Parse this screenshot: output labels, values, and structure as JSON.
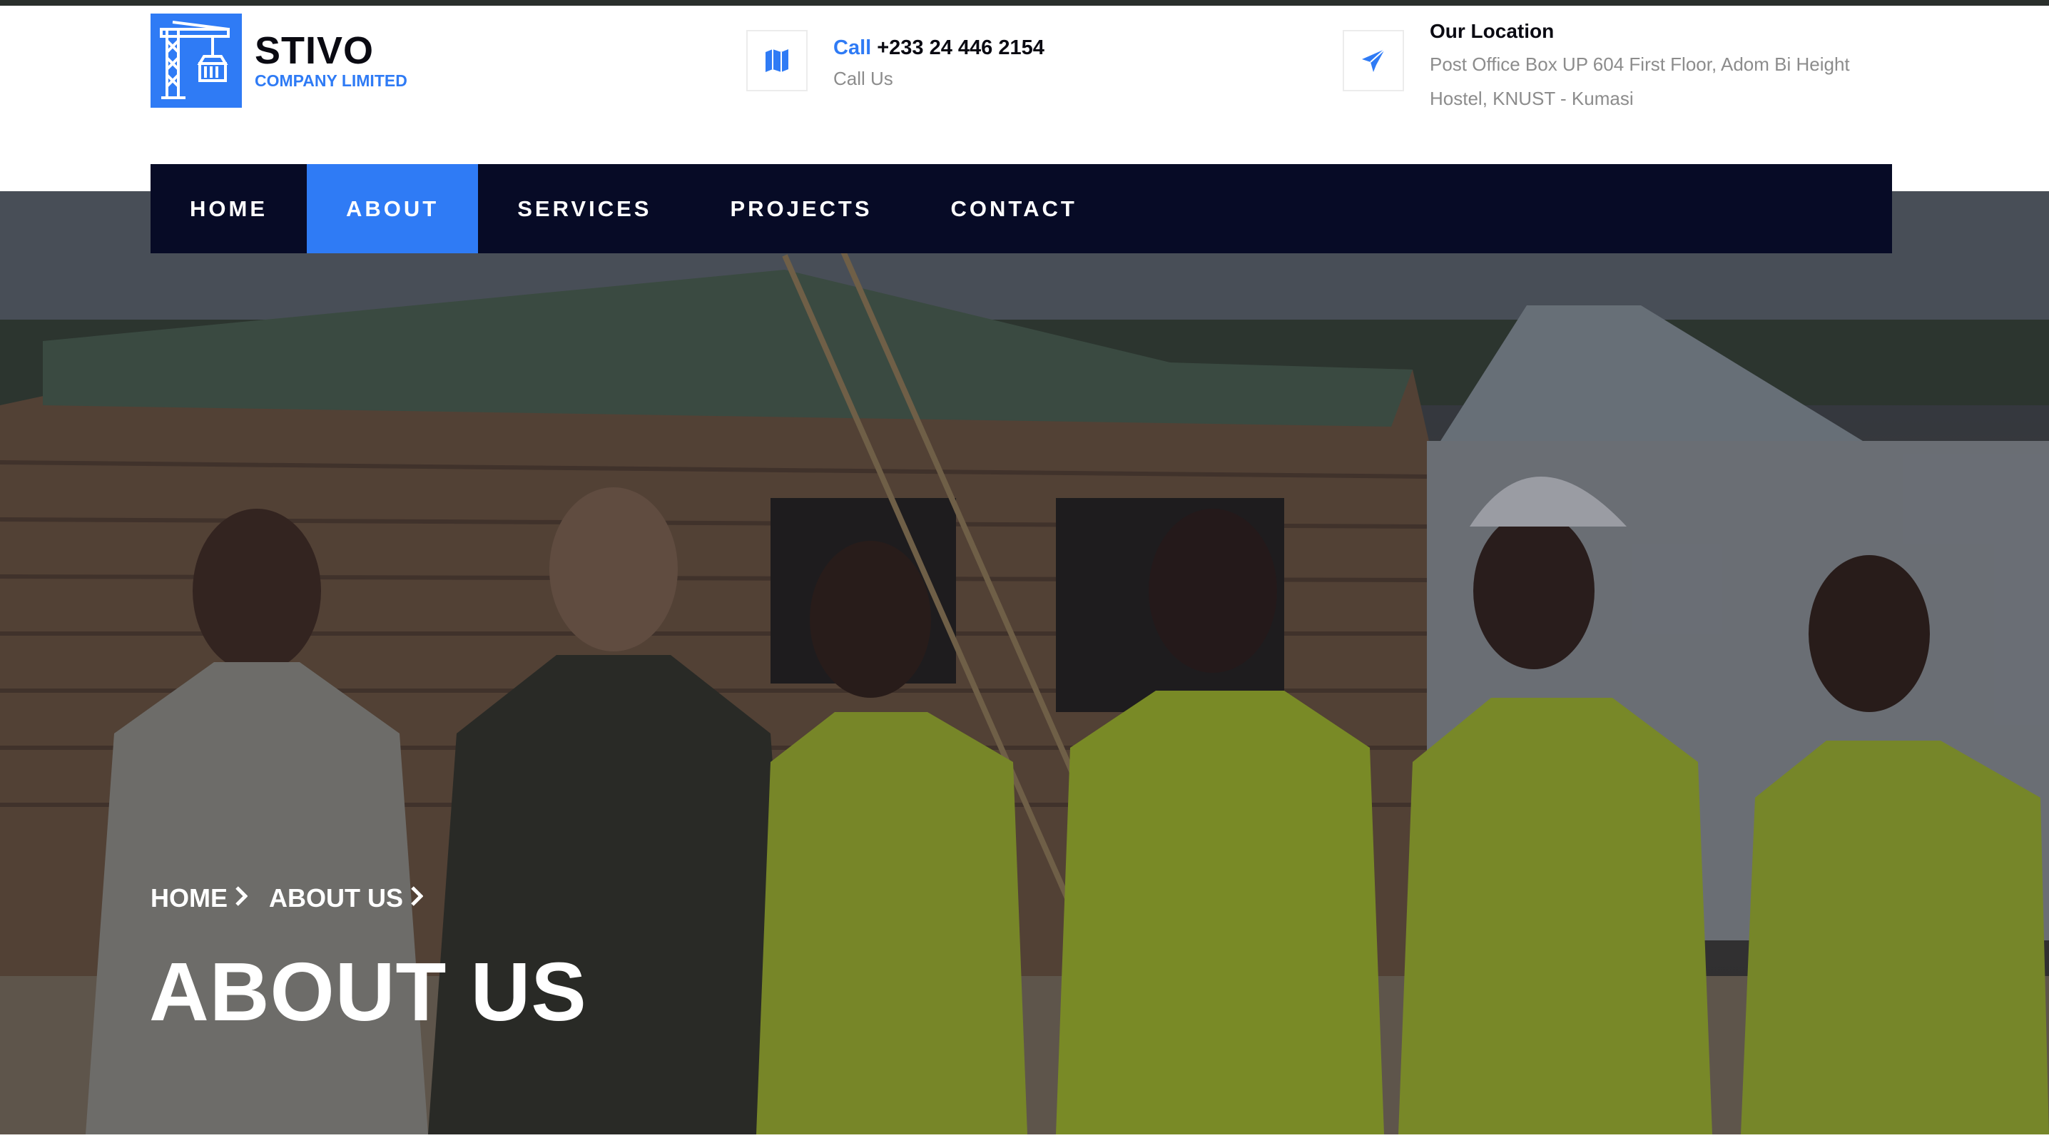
{
  "brand": {
    "name": "STIVO",
    "subtitle": "COMPANY LIMITED",
    "accent_color": "#2f7bf5",
    "logo_icon": "tower-crane-icon"
  },
  "contact": {
    "call_label": "Call",
    "phone": "+233 24 446 2154",
    "call_caption": "Call Us",
    "call_icon": "map-icon"
  },
  "location": {
    "title": "Our Location",
    "address": "Post Office Box UP 604 First Floor, Adom Bi Height Hostel, KNUST - Kumasi",
    "icon": "paper-plane-icon"
  },
  "nav": {
    "background": "#070b26",
    "items": [
      {
        "label": "HOME",
        "active": false
      },
      {
        "label": "ABOUT",
        "active": true
      },
      {
        "label": "SERVICES",
        "active": false
      },
      {
        "label": "PROJECTS",
        "active": false
      },
      {
        "label": "CONTACT",
        "active": false
      }
    ]
  },
  "hero": {
    "breadcrumb": [
      {
        "label": "HOME"
      },
      {
        "label": "ABOUT US"
      }
    ],
    "title": "ABOUT US"
  }
}
